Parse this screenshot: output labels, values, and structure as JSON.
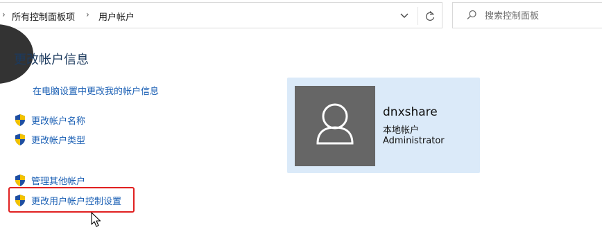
{
  "address_bar": {
    "breadcrumb": [
      {
        "label": "所有控制面板项"
      },
      {
        "label": "用户帐户"
      }
    ]
  },
  "search": {
    "placeholder": "搜索控制面板",
    "value": ""
  },
  "main": {
    "title": "更改帐户信息",
    "pc_settings_link": "在电脑设置中更改我的帐户信息",
    "tasks": [
      {
        "label": "更改帐户名称",
        "icon": "uac-shield-icon"
      },
      {
        "label": "更改帐户类型",
        "icon": "uac-shield-icon"
      },
      {
        "label": "管理其他帐户",
        "icon": "uac-shield-icon"
      },
      {
        "label": "更改用户帐户控制设置",
        "icon": "uac-shield-icon"
      }
    ]
  },
  "account": {
    "name": "dnxshare",
    "type": "本地帐户",
    "role": "Administrator",
    "avatar_icon": "user-avatar-icon"
  },
  "colors": {
    "link": "#1a5fb4",
    "title": "#1c3a5e",
    "card_bg": "#dbeaf9",
    "avatar_bg": "#666666",
    "highlight": "#e02020"
  }
}
